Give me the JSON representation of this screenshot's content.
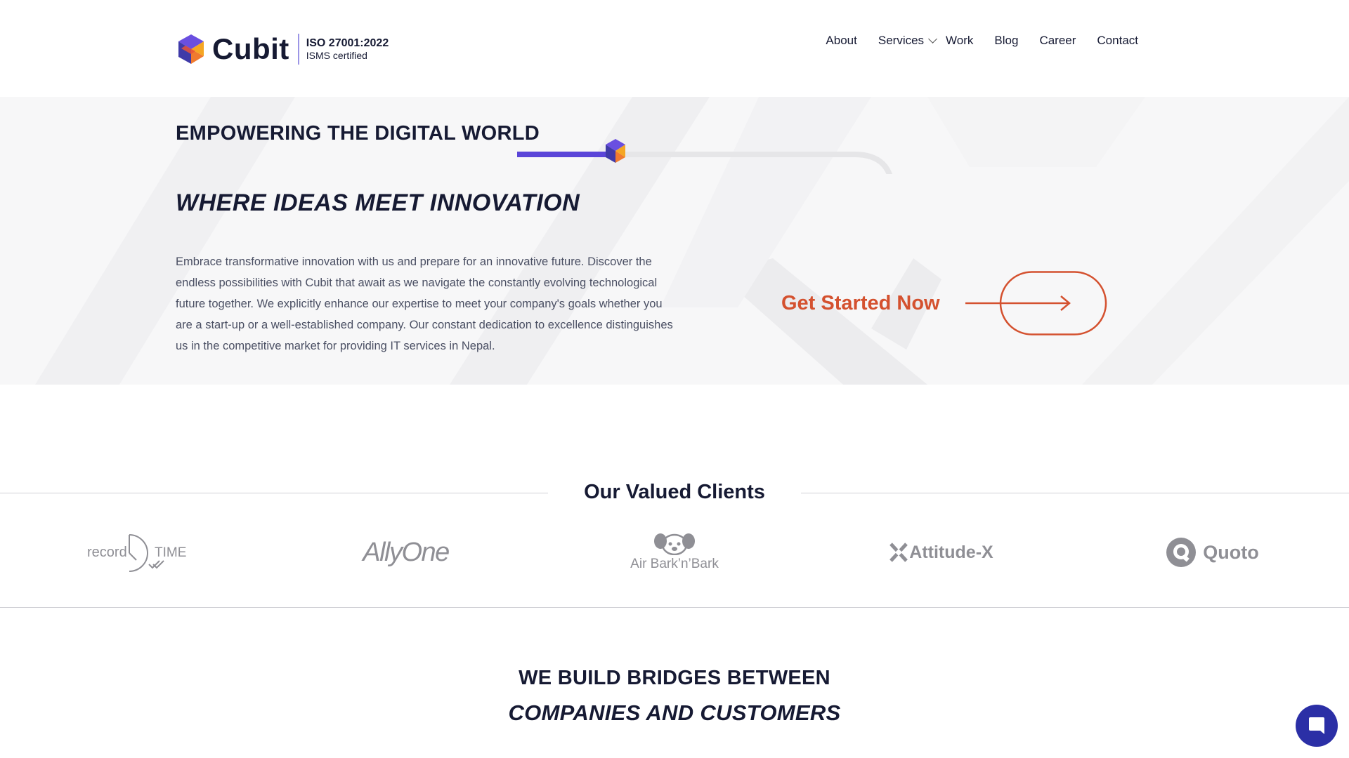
{
  "brand": {
    "name": "Cubit",
    "iso_title": "ISO 27001:2022",
    "iso_subtitle": "ISMS certified"
  },
  "nav": {
    "items": [
      {
        "label": "About"
      },
      {
        "label": "Services"
      },
      {
        "label": "Work"
      },
      {
        "label": "Blog"
      },
      {
        "label": "Career"
      },
      {
        "label": "Contact"
      }
    ]
  },
  "hero": {
    "eyebrow": "EMPOWERING THE DIGITAL WORLD",
    "title": "WHERE IDEAS MEET INNOVATION",
    "body": "Embrace transformative innovation with us and prepare for an innovative future. Discover the endless possibilities with Cubit that await as we navigate the constantly evolving technological future together. We explicitly enhance our expertise to meet your company's goals whether you are a start-up or a well-established company. Our constant dedication to excellence distinguishes us in the competitive market for providing IT services in Nepal.",
    "cta_label": "Get Started Now"
  },
  "clients": {
    "title": "Our Valued Clients",
    "logos": [
      {
        "name": "recordTIME",
        "text_a": "record",
        "text_b": "TIME"
      },
      {
        "name": "AllyOne",
        "text": "AllyOne"
      },
      {
        "name": "Air Bark'n'Bark",
        "text": "Air Bark’n’Bark"
      },
      {
        "name": "Attitude-X",
        "text": "Attitude-X"
      },
      {
        "name": "Quoto",
        "text": "Quoto"
      }
    ]
  },
  "bridges": {
    "line1": "WE BUILD BRIDGES BETWEEN",
    "line2": "COMPANIES AND CUSTOMERS"
  },
  "colors": {
    "brand_dark": "#161a33",
    "accent_orange": "#d4512f",
    "accent_purple": "#5a45d8",
    "chat_blue": "#2b2fa6"
  },
  "icons": {
    "logo": "cubit-logo-icon",
    "chat": "chat-bubble-icon",
    "cta": "arrow-right-icon",
    "services_dropdown": "chevron-down-icon"
  }
}
